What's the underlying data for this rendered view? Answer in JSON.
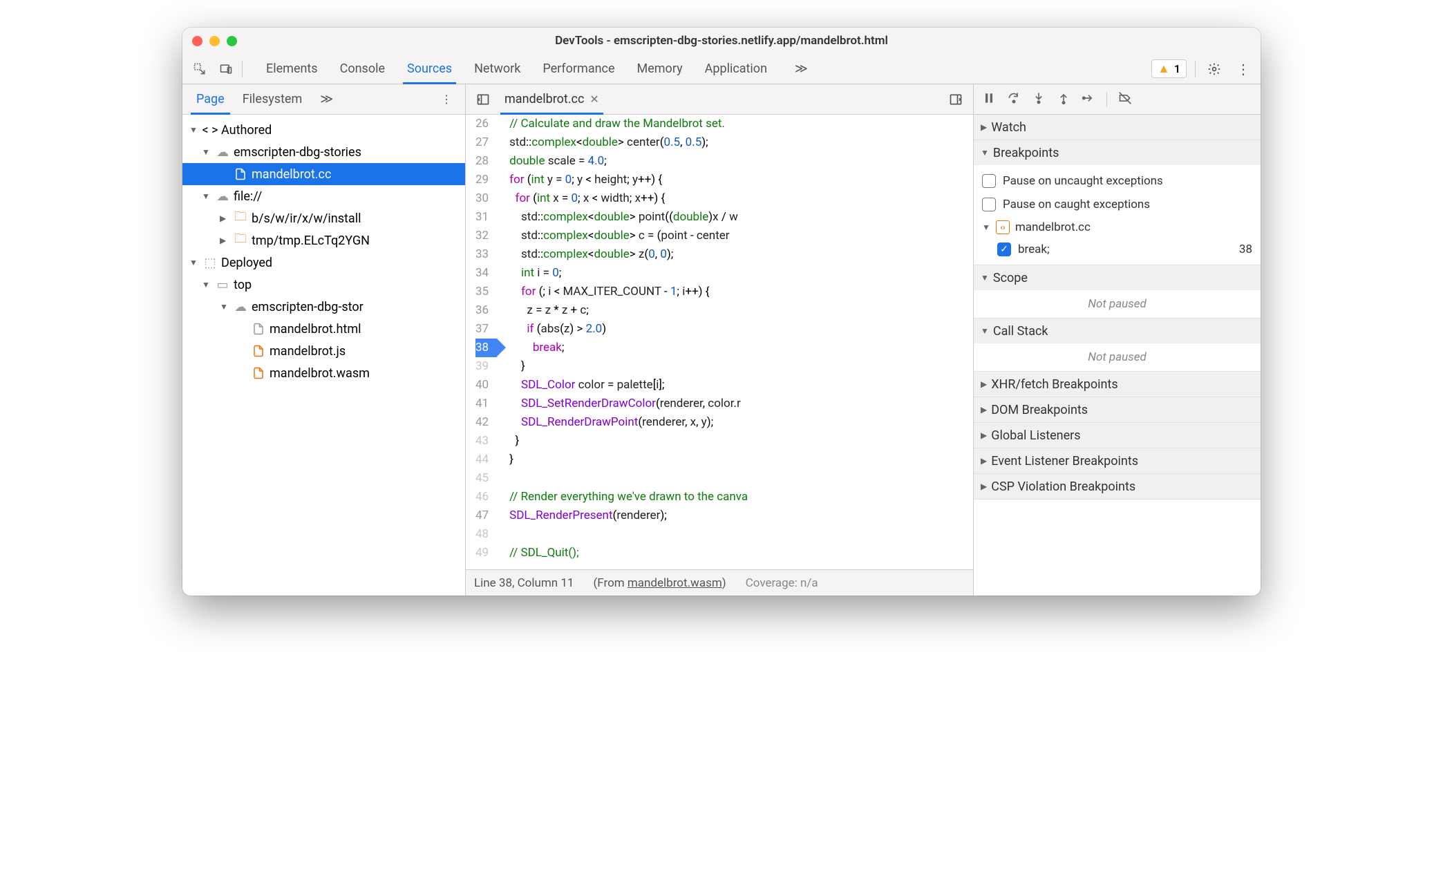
{
  "window": {
    "title": "DevTools - emscripten-dbg-stories.netlify.app/mandelbrot.html"
  },
  "toolbar": {
    "tabs": [
      "Elements",
      "Console",
      "Sources",
      "Network",
      "Performance",
      "Memory",
      "Application"
    ],
    "active": 2,
    "more": "≫",
    "warning_count": "1"
  },
  "sidebar": {
    "tabs": [
      "Page",
      "Filesystem"
    ],
    "active": 0,
    "more": "≫",
    "tree": {
      "authored": {
        "label": "Authored",
        "site": "emscripten-dbg-stories",
        "selected_file": "mandelbrot.cc",
        "file_proto": "file://",
        "folder1": "b/s/w/ir/x/w/install",
        "folder2": "tmp/tmp.ELcTq2YGN"
      },
      "deployed": {
        "label": "Deployed",
        "top": "top",
        "site": "emscripten-dbg-stor",
        "files": [
          "mandelbrot.html",
          "mandelbrot.js",
          "mandelbrot.wasm"
        ]
      }
    }
  },
  "editor": {
    "filename": "mandelbrot.cc",
    "lines": [
      {
        "n": 26,
        "html": "<span class='cm'>// Calculate and draw the Mandelbrot set.</span>"
      },
      {
        "n": 27,
        "html": "<span class='id'>std</span>::<span class='ty'>complex</span>&lt;<span class='ty'>double</span>&gt; <span class='id'>center</span>(<span class='nm'>0.5</span>, <span class='nm'>0.5</span>);"
      },
      {
        "n": 28,
        "html": "<span class='ty'>double</span> <span class='id'>scale</span> = <span class='nm'>4.0</span>;"
      },
      {
        "n": 29,
        "html": "<span class='kw'>for</span> (<span class='ty'>int</span> <span class='id'>y</span> = <span class='nm'>0</span>; <span class='id'>y</span> &lt; <span class='id'>height</span>; <span class='id'>y</span>++) {"
      },
      {
        "n": 30,
        "html": "  <span class='kw'>for</span> (<span class='ty'>int</span> <span class='id'>x</span> = <span class='nm'>0</span>; <span class='id'>x</span> &lt; <span class='id'>width</span>; <span class='id'>x</span>++) {"
      },
      {
        "n": 31,
        "html": "    <span class='id'>std</span>::<span class='ty'>complex</span>&lt;<span class='ty'>double</span>&gt; <span class='id'>point</span>((<span class='ty'>double</span>)<span class='id'>x</span> / <span class='id'>w</span>"
      },
      {
        "n": 32,
        "html": "    <span class='id'>std</span>::<span class='ty'>complex</span>&lt;<span class='ty'>double</span>&gt; <span class='id'>c</span> = (<span class='id'>point</span> - <span class='id'>center</span>"
      },
      {
        "n": 33,
        "html": "    <span class='id'>std</span>::<span class='ty'>complex</span>&lt;<span class='ty'>double</span>&gt; <span class='id'>z</span>(<span class='nm'>0</span>, <span class='nm'>0</span>);"
      },
      {
        "n": 34,
        "html": "    <span class='ty'>int</span> <span class='id'>i</span> = <span class='nm'>0</span>;"
      },
      {
        "n": 35,
        "html": "    <span class='kw'>for</span> (; <span class='id'>i</span> &lt; <span class='id'>MAX_ITER_COUNT</span> - <span class='nm'>1</span>; <span class='id'>i</span>++) {"
      },
      {
        "n": 36,
        "html": "      <span class='id'>z</span> = <span class='id'>z</span> * <span class='id'>z</span> + <span class='id'>c</span>;"
      },
      {
        "n": 37,
        "html": "      <span class='kw'>if</span> (<span class='id'>abs</span>(<span class='id'>z</span>) &gt; <span class='nm'>2.0</span>)"
      },
      {
        "n": 38,
        "html": "        <span class='kw'>break</span>;",
        "bp": true
      },
      {
        "n": 39,
        "html": "    }",
        "dim": true
      },
      {
        "n": 40,
        "html": "    <span class='fn'>SDL_Color</span> <span class='id'>color</span> = <span class='id'>palette</span>[<span class='id'>i</span>];"
      },
      {
        "n": 41,
        "html": "    <span class='fn'>SDL_SetRenderDrawColor</span>(<span class='id'>renderer</span>, <span class='id'>color</span>.<span class='id'>r</span>"
      },
      {
        "n": 42,
        "html": "    <span class='fn'>SDL_RenderDrawPoint</span>(<span class='id'>renderer</span>, <span class='id'>x</span>, <span class='id'>y</span>);"
      },
      {
        "n": 43,
        "html": "  }",
        "dim": true
      },
      {
        "n": 44,
        "html": "}",
        "dim": true
      },
      {
        "n": 45,
        "html": "",
        "dim": true
      },
      {
        "n": 46,
        "html": "<span class='cm'>// Render everything we've drawn to the canva</span>",
        "dim": true
      },
      {
        "n": 47,
        "html": "<span class='fn'>SDL_RenderPresent</span>(<span class='id'>renderer</span>);"
      },
      {
        "n": 48,
        "html": "",
        "dim": true
      },
      {
        "n": 49,
        "html": "<span class='cm'>// SDL_Quit();</span>",
        "dim": true
      }
    ],
    "status": {
      "pos": "Line 38, Column 11",
      "from_label": "(From ",
      "from_file": "mandelbrot.wasm",
      "from_close": ")",
      "coverage": "Coverage: n/a"
    }
  },
  "debugger": {
    "panes": {
      "watch": "Watch",
      "breakpoints": {
        "title": "Breakpoints",
        "opt1": "Pause on uncaught exceptions",
        "opt2": "Pause on caught exceptions",
        "file": "mandelbrot.cc",
        "line_text": "break;",
        "line_num": "38"
      },
      "scope": {
        "title": "Scope",
        "body": "Not paused"
      },
      "callstack": {
        "title": "Call Stack",
        "body": "Not paused"
      },
      "xhr": "XHR/fetch Breakpoints",
      "dom": "DOM Breakpoints",
      "global": "Global Listeners",
      "event": "Event Listener Breakpoints",
      "csp": "CSP Violation Breakpoints"
    }
  }
}
